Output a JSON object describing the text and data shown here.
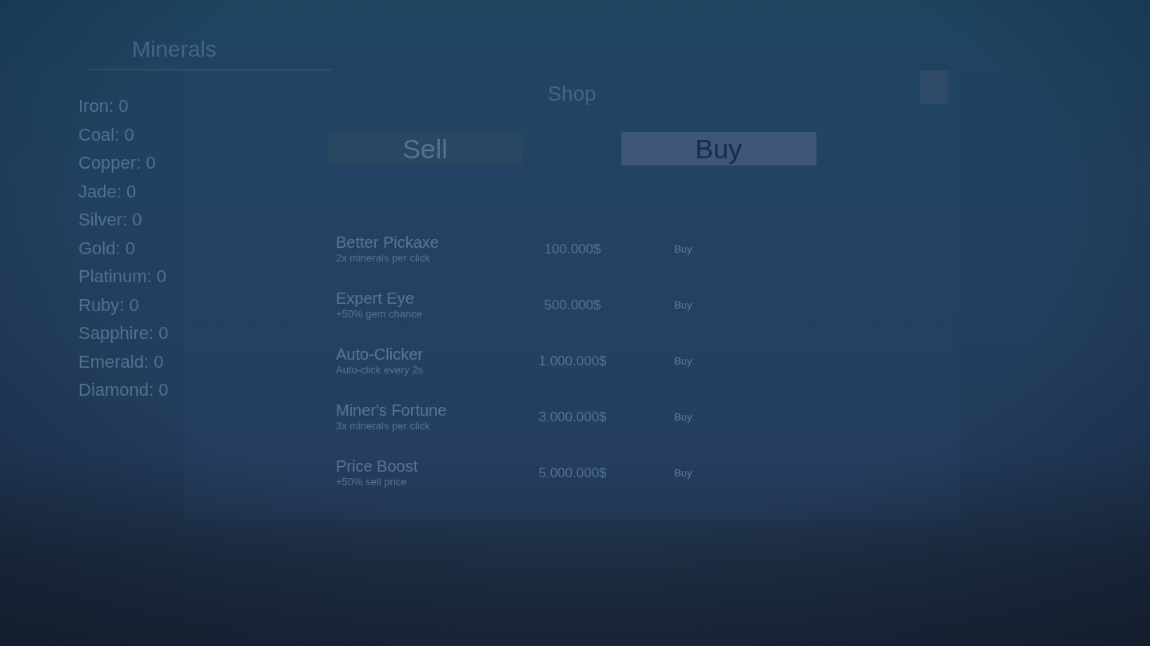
{
  "minerals": {
    "title": "Minerals",
    "items": [
      "Iron: 0",
      "Coal: 0",
      "Copper: 0",
      "Jade: 0",
      "Silver: 0",
      "Gold: 0",
      "Platinum: 0",
      "Ruby: 0",
      "Sapphire: 0",
      "Emerald: 0",
      "Diamond: 0"
    ]
  },
  "shop": {
    "title": "Shop",
    "tabs": [
      {
        "label": "Sell",
        "selected": false
      },
      {
        "label": "Buy",
        "selected": true
      }
    ],
    "items": [
      {
        "name": "Better Pickaxe",
        "description": "2x minerals per click",
        "price": "100.000$",
        "button": "Buy"
      },
      {
        "name": "Expert Eye",
        "description": "+50% gem chance",
        "price": "500.000$",
        "button": "Buy"
      },
      {
        "name": "Auto-Clicker",
        "description": "Auto-click every 2s",
        "price": "1.000.000$",
        "button": "Buy"
      },
      {
        "name": "Miner's Fortune",
        "description": "3x minerals per click",
        "price": "3.000.000$",
        "button": "Buy"
      },
      {
        "name": "Price Boost",
        "description": "+50% sell price",
        "price": "5.000.000$",
        "button": "Buy"
      }
    ]
  }
}
